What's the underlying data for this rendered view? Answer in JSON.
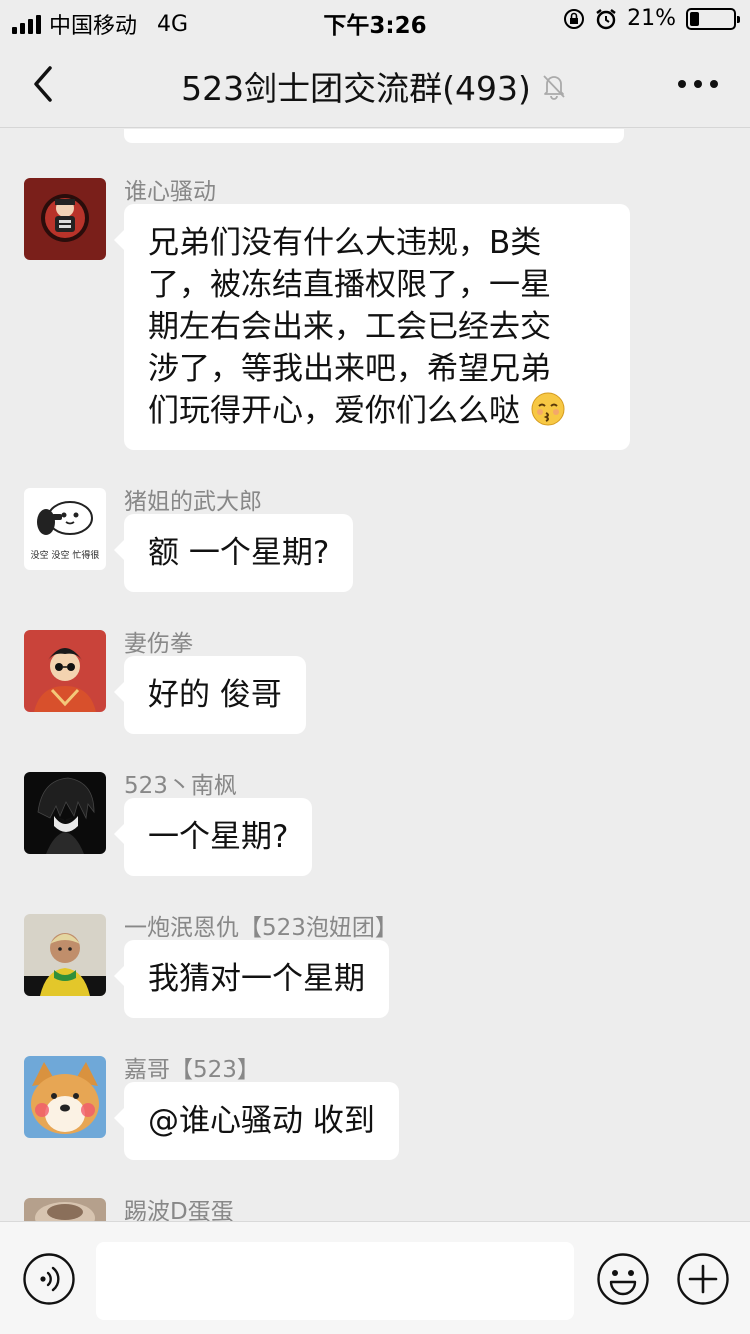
{
  "status_bar": {
    "carrier": "中国移动",
    "network": "4G",
    "time": "下午3:26",
    "battery": "21%",
    "battery_level": 0.21
  },
  "nav": {
    "title": "523剑士团交流群(493)",
    "back_icon": "chevron-left-icon",
    "mute_icon": "bell-off-icon",
    "more_icon": "more-dots-icon"
  },
  "messages": [
    {
      "sender": "谁心骚动",
      "lines": [
        "兄弟们没有什么大违规，B类",
        "了，被冻结直播权限了，一星",
        "期左右会出来，工会已经去交",
        "涉了，等我出来吧，希望兄弟",
        "们玩得开心，爱你们么么哒"
      ],
      "emoji": "kissing-face-emoji"
    },
    {
      "sender": "猪姐的武大郎",
      "text": "额  一个星期?",
      "avatar_caption": "没空  没空  忙得很"
    },
    {
      "sender": "妻伤拳",
      "text": "好的 俊哥"
    },
    {
      "sender": "523丶南枫",
      "text": "一个星期?"
    },
    {
      "sender": "一炮泯恩仇【523泡妞团】",
      "text": "我猜对一个星期"
    },
    {
      "sender": "嘉哥【523】",
      "text": "@谁心骚动 收到"
    },
    {
      "sender": "踢波D蛋蛋"
    }
  ],
  "input_bar": {
    "voice_icon": "voice-icon",
    "emoji_icon": "smiley-icon",
    "plus_icon": "plus-icon",
    "input_value": ""
  }
}
